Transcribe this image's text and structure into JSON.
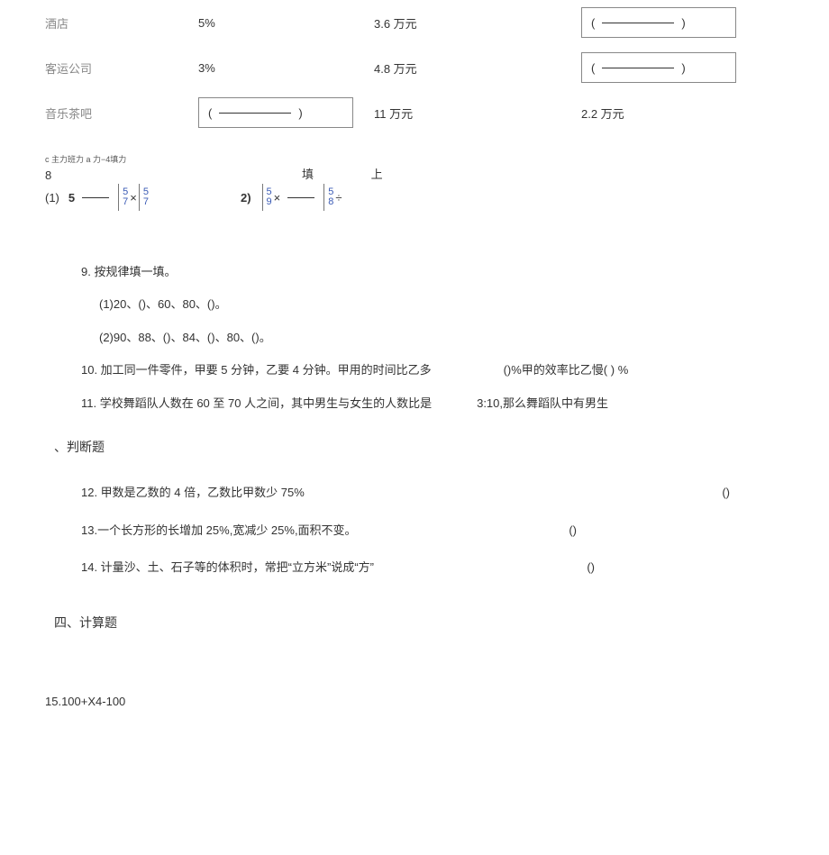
{
  "table": {
    "row1": {
      "label": "酒店",
      "rate": "5%",
      "amount": "3.6 万元",
      "input": "(",
      "input_close": ")"
    },
    "row2": {
      "label": "客运公司",
      "rate": "3%",
      "amount": "4.8 万元",
      "input": "(",
      "input_close": ")"
    },
    "row3": {
      "label": "音乐茶吧",
      "input": "(",
      "input_close": ")",
      "amount": "11 万元",
      "value": "2.2 万元"
    }
  },
  "q8": {
    "tiny": "c 主力班力 a 力−4填力",
    "num": "8",
    "fill_label_1": "填",
    "fill_label_2": "上",
    "item1": "(1)",
    "five": "5",
    "times": "×",
    "frac1_top": "5",
    "frac1_bot": "7",
    "item2": "2)",
    "plus": "÷",
    "frac2a_top": "5",
    "frac2a_bot": "9",
    "frac2b_top": "5",
    "frac2b_bot": "8"
  },
  "q9": {
    "title": "9. 按规律填一填。",
    "sub1": "(1)20、()、60、80、()。",
    "sub2": "(2)90、88、()、84、()、80、()。"
  },
  "q10": {
    "left": "10. 加工同一件零件，甲要 5 分钟，乙要 4 分钟。甲用的时间比乙多",
    "right": "()%甲的效率比乙慢( ) %"
  },
  "q11": {
    "left": "11. 学校舞蹈队人数在 60 至 70 人之间，其中男生与女生的人数比是",
    "right": "3:10,那么舞蹈队中有男生"
  },
  "judge_heading": "、判断题",
  "q12": {
    "text": "12. 甲数是乙数的 4 倍，乙数比甲数少 75%",
    "mark": "()"
  },
  "q13": {
    "text": "13.一个长方形的长增加 25%,宽减少 25%,面积不变。",
    "mark": "()"
  },
  "q14": {
    "text": "14. 计量沙、土、石子等的体积时，常把“立方米”说成“方”",
    "mark": "()"
  },
  "calc_heading": "四、计算题",
  "q15": "15.100+X4-100"
}
